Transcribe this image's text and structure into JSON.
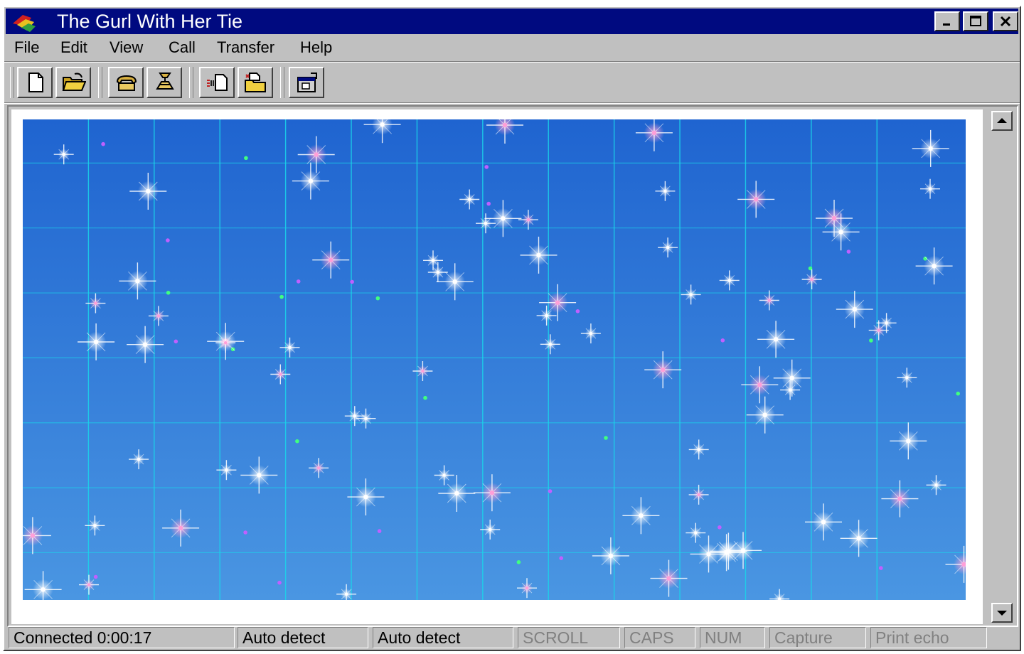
{
  "window": {
    "title": "The Gurl With Her Tie"
  },
  "menu": [
    {
      "label": "File"
    },
    {
      "label": "Edit"
    },
    {
      "label": "View"
    },
    {
      "label": "Call"
    },
    {
      "label": "Transfer"
    },
    {
      "label": "Help"
    }
  ],
  "toolbar": {
    "buttons": [
      {
        "name": "new-button",
        "icon": "new-document-icon"
      },
      {
        "name": "open-button",
        "icon": "open-folder-icon"
      },
      {
        "name": "connect-button",
        "icon": "phone-icon"
      },
      {
        "name": "disconnect-button",
        "icon": "hang-up-icon"
      },
      {
        "name": "send-button",
        "icon": "send-file-icon"
      },
      {
        "name": "receive-button",
        "icon": "receive-file-icon"
      },
      {
        "name": "properties-button",
        "icon": "properties-icon"
      }
    ]
  },
  "terminal": {
    "background_colors": [
      "#1f64d0",
      "#4a96e2"
    ],
    "grid_color": "#1ad6ea",
    "star_colors": [
      "#ffffff",
      "#ff9fd8",
      "#c060ff",
      "#40ff80"
    ]
  },
  "status": {
    "connection": "Connected 0:00:17",
    "emulation": "Auto detect",
    "port": "Auto detect",
    "scroll": "SCROLL",
    "caps": "CAPS",
    "num": "NUM",
    "capture": "Capture",
    "print_echo": "Print echo"
  }
}
